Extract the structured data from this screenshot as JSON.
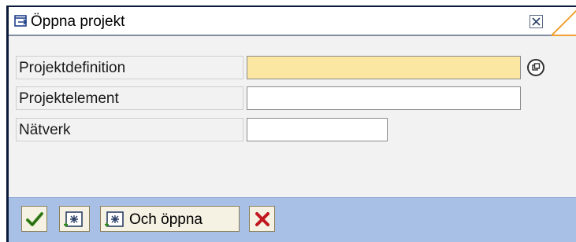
{
  "dialog": {
    "title": "Öppna projekt",
    "title_icon": "open-folder-arrow-icon",
    "close_icon": "close-x-icon"
  },
  "form": {
    "fields": [
      {
        "label": "Projektdefinition",
        "value": "",
        "required": true,
        "search_help_icon": "search-help-icon"
      },
      {
        "label": "Projektelement",
        "value": ""
      },
      {
        "label": "Nätverk",
        "value": ""
      }
    ]
  },
  "toolbar": {
    "buttons": [
      {
        "icon": "checkmark-icon"
      },
      {
        "icon": "new-entry-icon"
      },
      {
        "icon": "new-entry-icon",
        "label": "Och öppna"
      },
      {
        "icon": "cancel-x-icon"
      }
    ]
  },
  "colors": {
    "required_field": "#fbe7a1",
    "toolbar_bg": "#a9c0e6",
    "dialog_border": "#0b1a3a",
    "accent_orange": "#f0a030"
  }
}
